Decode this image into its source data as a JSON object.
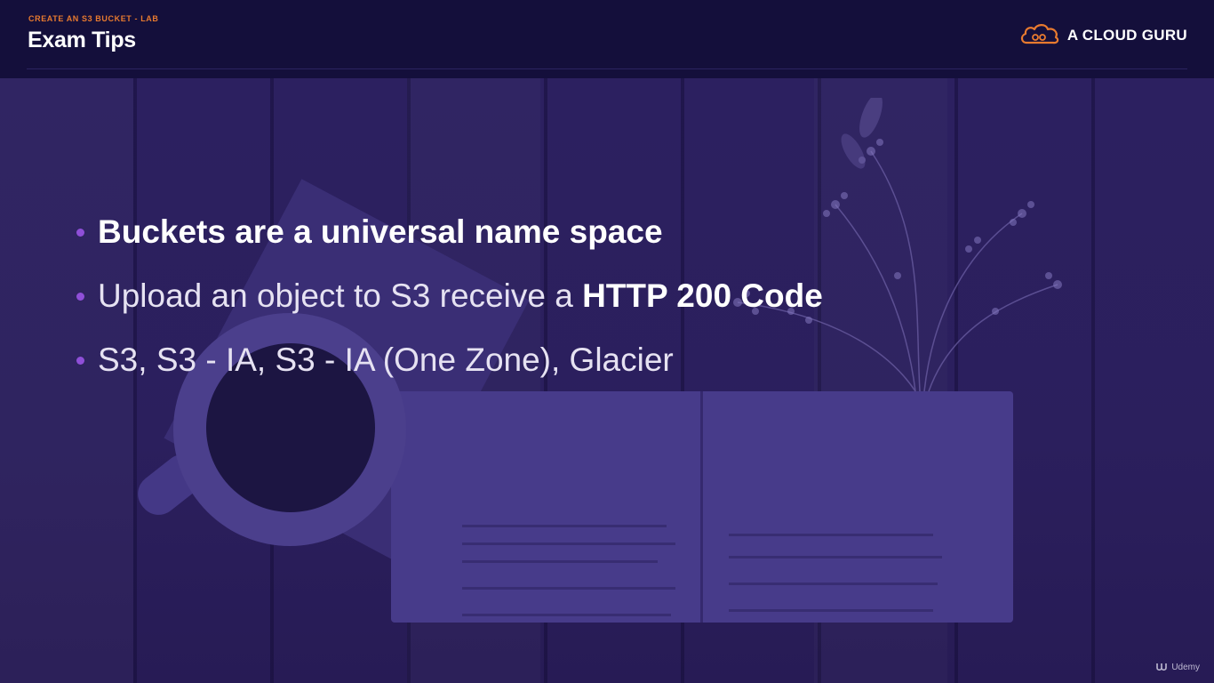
{
  "header": {
    "subtitle": "CREATE AN S3 BUCKET - LAB",
    "title": "Exam Tips",
    "logo_text": "A CLOUD GURU"
  },
  "bullets": [
    {
      "plain_before": "",
      "bold": "Buckets are a universal name space",
      "plain_after": ""
    },
    {
      "plain_before": "Upload an object to S3 receive a ",
      "bold": "HTTP 200 Code",
      "plain_after": ""
    },
    {
      "plain_before": "S3, S3 - IA, S3 - IA (One Zone), Glacier",
      "bold": "",
      "plain_after": ""
    }
  ],
  "watermark": {
    "text": "Udemy"
  },
  "colors": {
    "accent": "#e87a2f",
    "bullet_dot": "#8f4fd8",
    "header_bg": "#140f3b"
  },
  "icons": [
    "cloud-logo-icon",
    "udemy-logo-icon"
  ]
}
